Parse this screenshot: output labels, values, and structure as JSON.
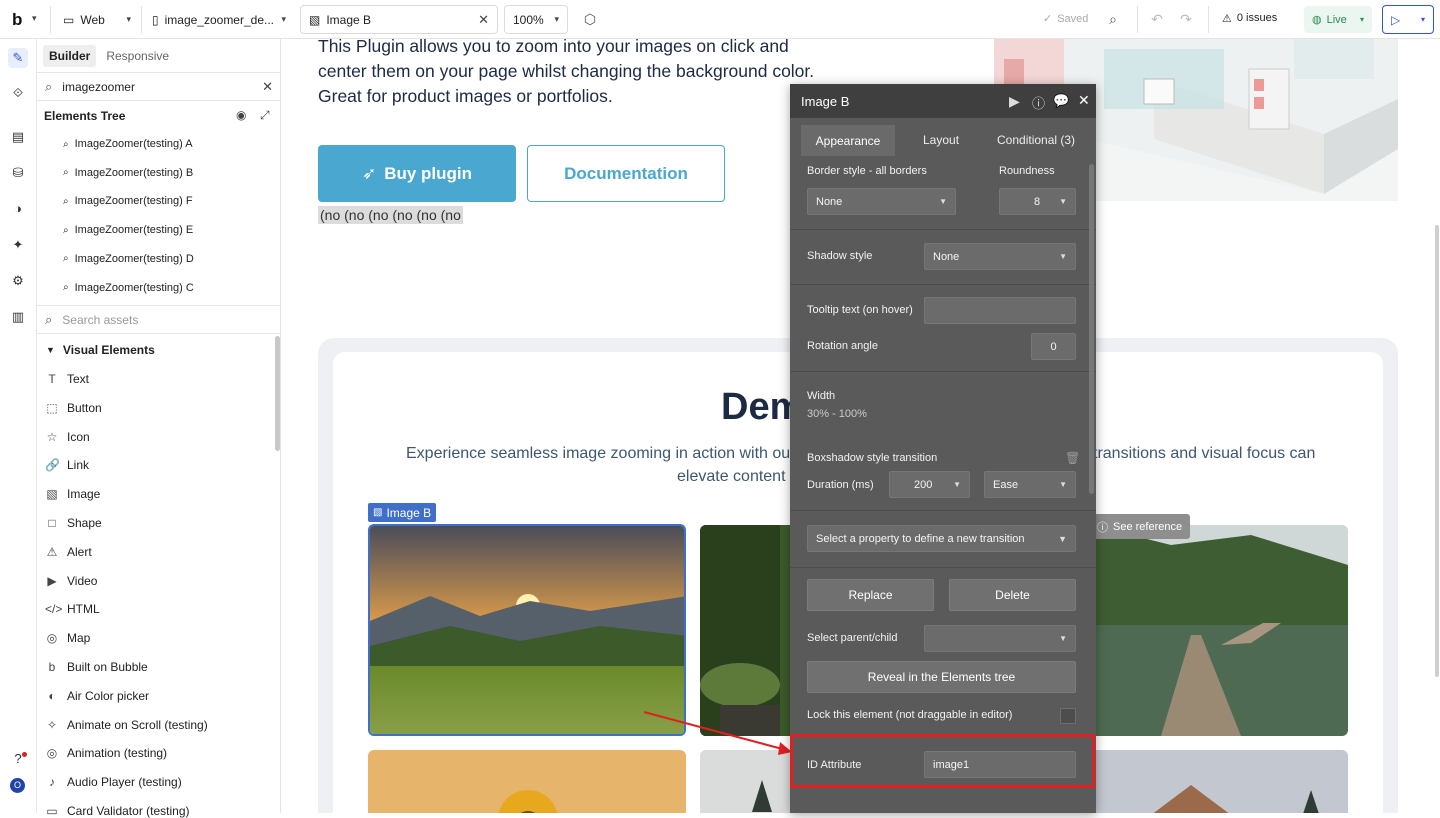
{
  "topbar": {
    "logo": "b",
    "device": "Web",
    "page": "image_zoomer_de...",
    "element": "Image B",
    "zoom": "100%",
    "saved": "Saved",
    "issues": "0 issues",
    "live": "Live"
  },
  "left": {
    "tabs": [
      "Builder",
      "Responsive"
    ],
    "search_value": "imagezoomer",
    "tree_title": "Elements Tree",
    "tree_items": [
      "ImageZoomer(testing) A",
      "ImageZoomer(testing) B",
      "ImageZoomer(testing) F",
      "ImageZoomer(testing) E",
      "ImageZoomer(testing) D",
      "ImageZoomer(testing) C"
    ],
    "assets_placeholder": "Search assets",
    "section_title": "Visual Elements",
    "elements": [
      {
        "label": "Text",
        "icon": "T"
      },
      {
        "label": "Button",
        "icon": "⬚"
      },
      {
        "label": "Icon",
        "icon": "☆"
      },
      {
        "label": "Link",
        "icon": "🔗"
      },
      {
        "label": "Image",
        "icon": "▧"
      },
      {
        "label": "Shape",
        "icon": "□"
      },
      {
        "label": "Alert",
        "icon": "⚠"
      },
      {
        "label": "Video",
        "icon": "▶"
      },
      {
        "label": "HTML",
        "icon": "</>"
      },
      {
        "label": "Map",
        "icon": "◎"
      },
      {
        "label": "Built on Bubble",
        "icon": "b"
      },
      {
        "label": "Air Color picker",
        "icon": "◐"
      },
      {
        "label": "Animate on Scroll (testing)",
        "icon": "✧"
      },
      {
        "label": "Animation (testing)",
        "icon": "◎"
      },
      {
        "label": "Audio Player (testing)",
        "icon": "♪"
      },
      {
        "label": "Card Validator (testing)",
        "icon": "▭"
      }
    ]
  },
  "canvas": {
    "intro": "This Plugin allows you to zoom into your images on click and center them on your page whilst changing the background color. Great for product images or portfolios.",
    "buy_button": "Buy plugin",
    "doc_button": "Documentation",
    "placeholder_text": "(no (no (no (no (no (no",
    "demo_title": "Dem",
    "demo_sub": "Experience seamless image zooming in action with our ... transitions and visual focus can elevate content",
    "demo_sub_left": "Experience seamless image zooming in action with our",
    "demo_sub_right": "transitions and visual focus can",
    "demo_sub_line2": "elevate content",
    "selected_tag": "Image B",
    "see_reference": "See reference"
  },
  "editor": {
    "title": "Image B",
    "tabs": [
      "Appearance",
      "Layout",
      "Conditional (3)"
    ],
    "border_label": "Border style - all borders",
    "border_value": "None",
    "roundness_label": "Roundness",
    "roundness_value": "8",
    "shadow_label": "Shadow style",
    "shadow_value": "None",
    "tooltip_label": "Tooltip text (on hover)",
    "tooltip_value": "",
    "rotation_label": "Rotation angle",
    "rotation_value": "0",
    "width_label": "Width",
    "width_value": "30% - 100%",
    "transition_label": "Boxshadow style transition",
    "duration_label": "Duration (ms)",
    "duration_value": "200",
    "easing_value": "Ease",
    "new_transition": "Select a property to define a new transition",
    "replace": "Replace",
    "delete": "Delete",
    "parent_label": "Select parent/child",
    "reveal": "Reveal in the Elements tree",
    "lock_label": "Lock this element (not draggable in editor)",
    "id_label": "ID Attribute",
    "id_value": "image1"
  },
  "colors": {
    "accent_blue": "#4aa7cf",
    "highlight_red": "#e02020",
    "editor_bg": "#5a5a5a",
    "selection_blue": "#3f6fc8"
  }
}
